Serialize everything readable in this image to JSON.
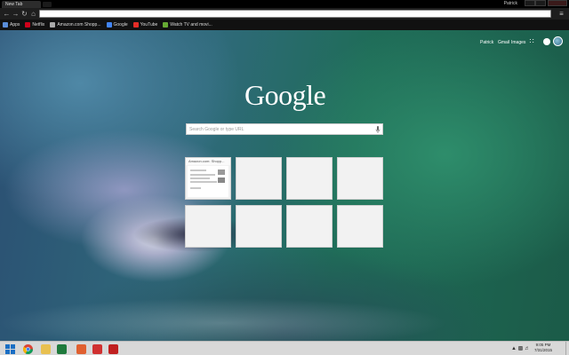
{
  "browser": {
    "tab_title": "New Tab",
    "profile_name": "Patrick",
    "url": ""
  },
  "bookmarks": [
    {
      "label": "Apps",
      "icon": "apps-grid-icon",
      "color": "#5a8dd8"
    },
    {
      "label": "Netflix",
      "icon": "netflix-icon",
      "color": "#d0021b"
    },
    {
      "label": "Amazon.com Shopp...",
      "icon": "amazon-icon",
      "color": "#aaaaaa"
    },
    {
      "label": "Google",
      "icon": "google-icon",
      "color": "#4285f4"
    },
    {
      "label": "YouTube",
      "icon": "youtube-icon",
      "color": "#e52d27"
    },
    {
      "label": "Watch TV and movi...",
      "icon": "hulu-icon",
      "color": "#66aa33"
    }
  ],
  "ntp": {
    "links": [
      "Patrick",
      "Gmail",
      "Images"
    ],
    "logo": "Google",
    "search_placeholder": "Search Google or type URL",
    "tiles": [
      {
        "title": "Amazon.com: Shopp...",
        "has_thumbnail": true
      },
      {
        "title": "",
        "has_thumbnail": false
      },
      {
        "title": "",
        "has_thumbnail": false
      },
      {
        "title": "",
        "has_thumbnail": false
      },
      {
        "title": "",
        "has_thumbnail": false
      },
      {
        "title": "",
        "has_thumbnail": false
      },
      {
        "title": "",
        "has_thumbnail": false
      },
      {
        "title": "",
        "has_thumbnail": false
      }
    ]
  },
  "taskbar": {
    "apps": [
      {
        "name": "start",
        "icon": "windows-logo-icon",
        "color": "#1a6fc4"
      },
      {
        "name": "chrome",
        "icon": "chrome-icon",
        "color": "#e8b820"
      },
      {
        "name": "file-explorer",
        "icon": "folder-icon",
        "color": "#e8c050"
      },
      {
        "name": "excel",
        "icon": "excel-icon",
        "color": "#1f7a3c"
      },
      {
        "name": "app-orange",
        "icon": "orange-app-icon",
        "color": "#e06030"
      },
      {
        "name": "app-red",
        "icon": "red-app-icon",
        "color": "#d03030"
      },
      {
        "name": "app-media",
        "icon": "media-app-icon",
        "color": "#c02020"
      }
    ],
    "time": "9:05 PM",
    "date": "7/31/2015"
  }
}
